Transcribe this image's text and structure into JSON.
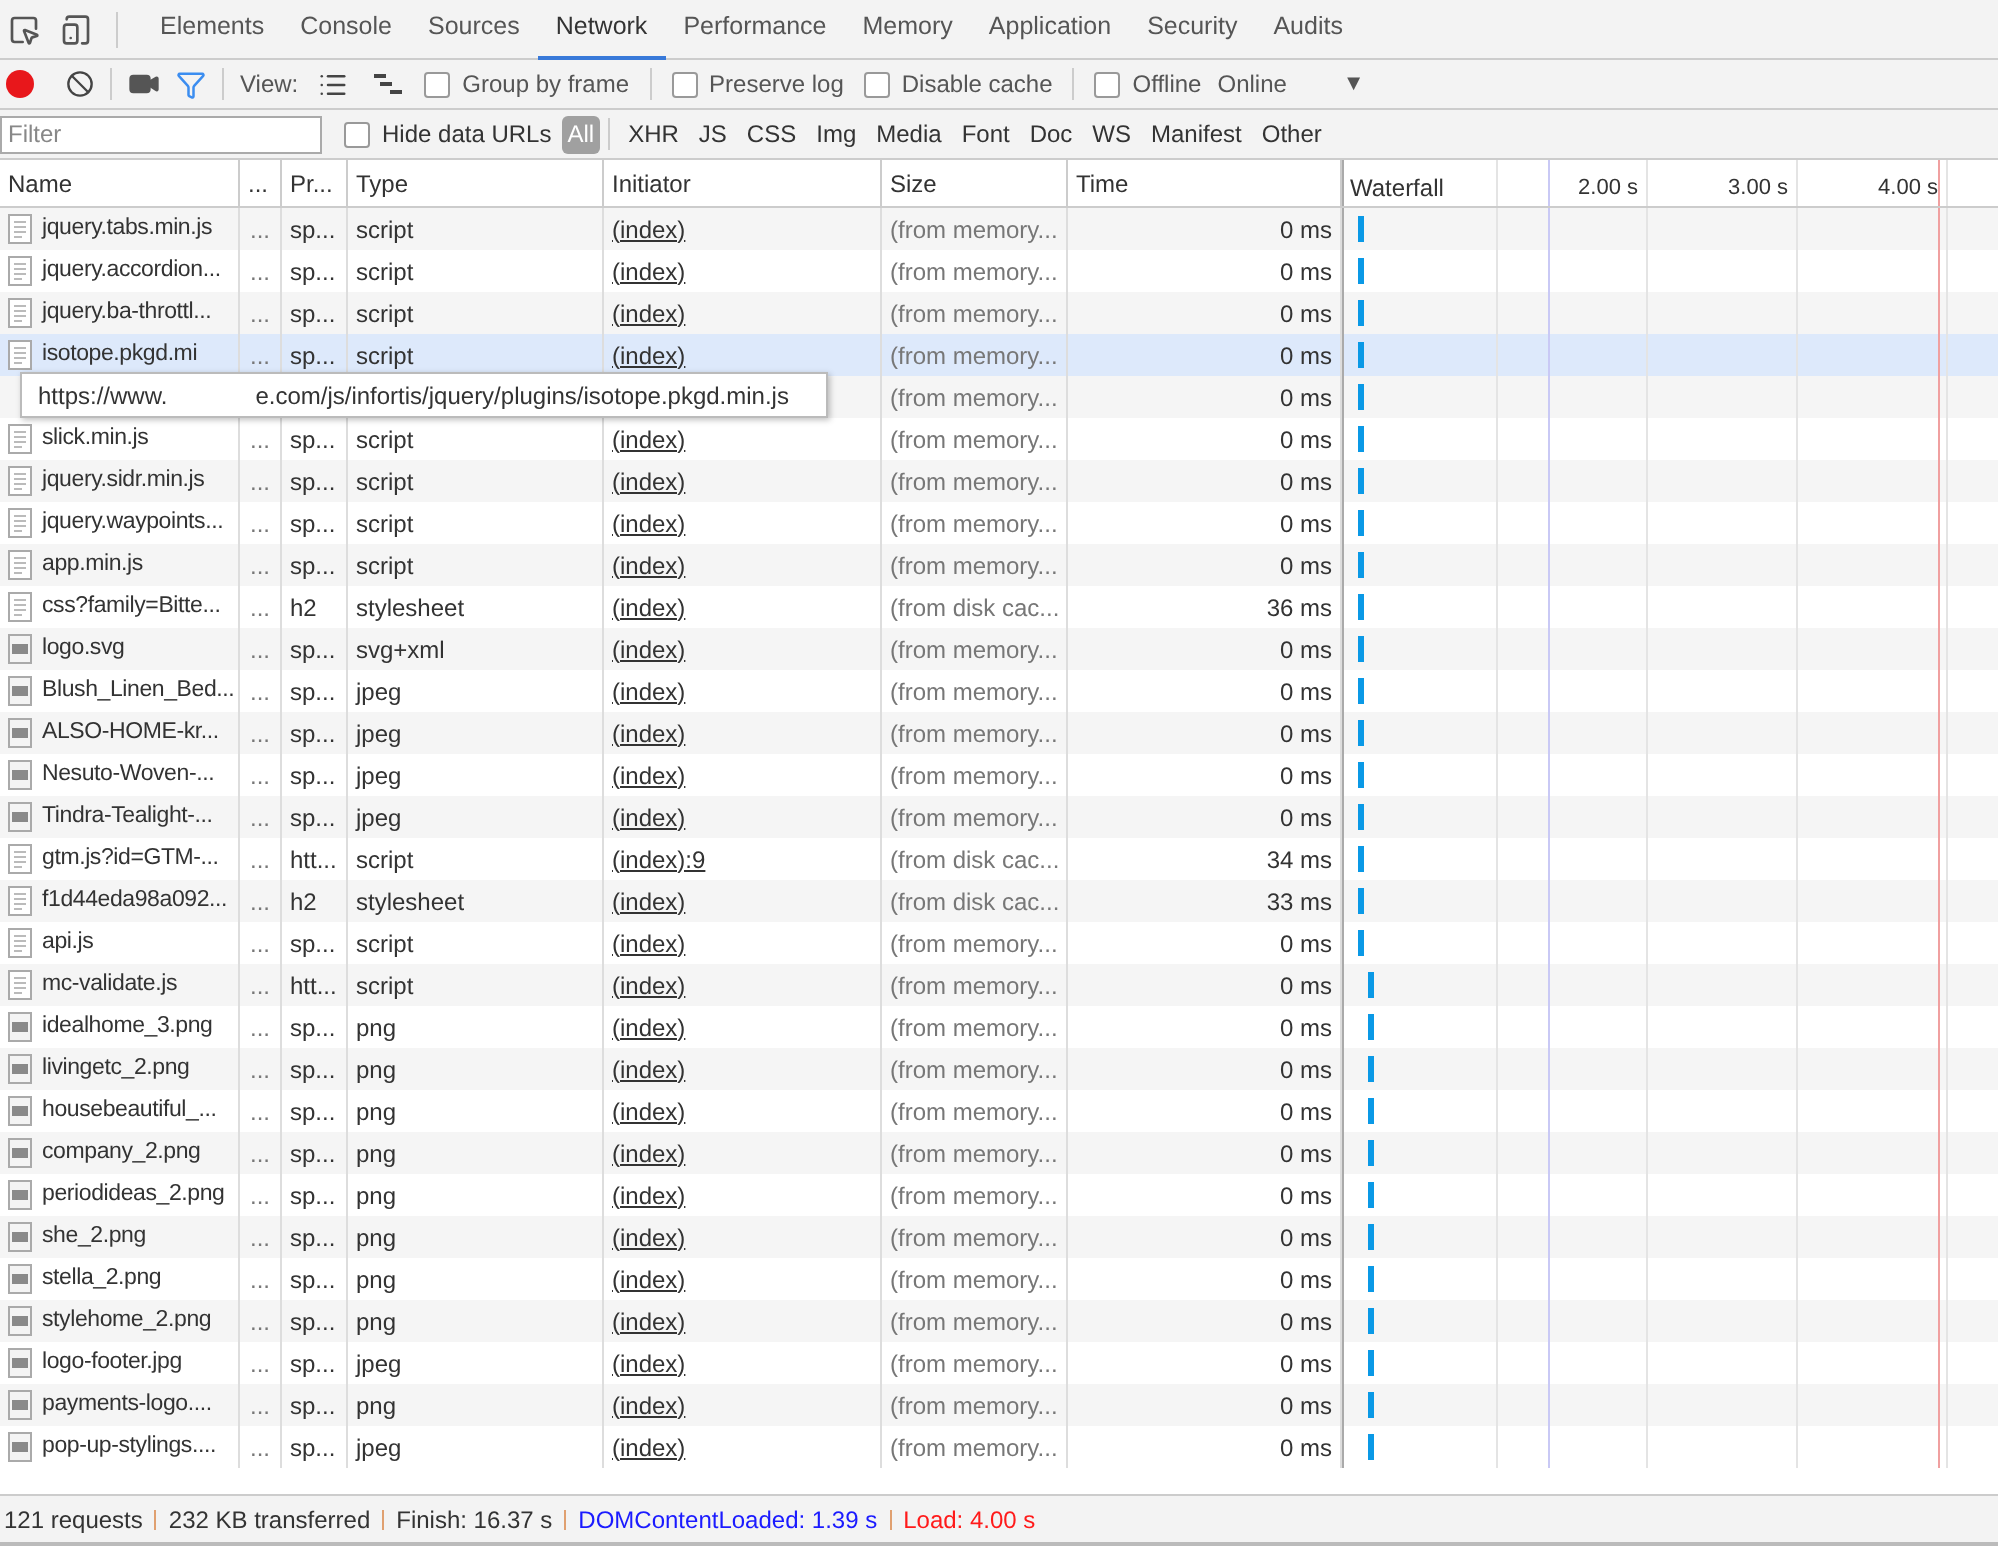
{
  "tabs": [
    {
      "label": "Elements",
      "selected": false
    },
    {
      "label": "Console",
      "selected": false
    },
    {
      "label": "Sources",
      "selected": false
    },
    {
      "label": "Network",
      "selected": true
    },
    {
      "label": "Performance",
      "selected": false
    },
    {
      "label": "Memory",
      "selected": false
    },
    {
      "label": "Application",
      "selected": false
    },
    {
      "label": "Security",
      "selected": false
    },
    {
      "label": "Audits",
      "selected": false
    }
  ],
  "toolbar": {
    "recording": true,
    "filter_on": true,
    "view_label": "View:",
    "checkboxes": [
      {
        "label": "Group by frame",
        "checked": false
      },
      {
        "label": "Preserve log",
        "checked": false
      },
      {
        "label": "Disable cache",
        "checked": false
      },
      {
        "label": "Offline",
        "checked": false
      }
    ],
    "throttle": "Online",
    "throttle_caret": "▼"
  },
  "filter_bar": {
    "placeholder": "Filter",
    "hide_data_urls": {
      "label": "Hide data URLs",
      "checked": false
    },
    "types": [
      {
        "label": "All",
        "selected": true
      },
      {
        "label": "XHR",
        "selected": false
      },
      {
        "label": "JS",
        "selected": false
      },
      {
        "label": "CSS",
        "selected": false
      },
      {
        "label": "Img",
        "selected": false
      },
      {
        "label": "Media",
        "selected": false
      },
      {
        "label": "Font",
        "selected": false
      },
      {
        "label": "Doc",
        "selected": false
      },
      {
        "label": "WS",
        "selected": false
      },
      {
        "label": "Manifest",
        "selected": false
      },
      {
        "label": "Other",
        "selected": false
      }
    ]
  },
  "table": {
    "columns": [
      "Name",
      "...",
      "Pr...",
      "Type",
      "Initiator",
      "Size",
      "Time",
      "Waterfall"
    ],
    "waterfall_ticks": [
      "2.00 s",
      "3.00 s",
      "4.00 s"
    ],
    "rows": [
      {
        "kind": "file",
        "name": "jquery.tabs.min.js",
        "column_2": "...",
        "protocol": "sp...",
        "type": "script",
        "initiator": "(index)",
        "size": "(from memory...",
        "time": "0 ms",
        "hovered": false
      },
      {
        "kind": "file",
        "name": "jquery.accordion...",
        "column_2": "...",
        "protocol": "sp...",
        "type": "script",
        "initiator": "(index)",
        "size": "(from memory...",
        "time": "0 ms",
        "hovered": false
      },
      {
        "kind": "file",
        "name": "jquery.ba-throttl...",
        "column_2": "...",
        "protocol": "sp...",
        "type": "script",
        "initiator": "(index)",
        "size": "(from memory...",
        "time": "0 ms",
        "hovered": false
      },
      {
        "kind": "file",
        "name": "isotope.pkgd.mi",
        "column_2": "...",
        "protocol": "sp...",
        "type": "script",
        "initiator": "(index)",
        "size": "(from memory...",
        "time": "0 ms",
        "hovered": true
      },
      {
        "kind": "covered",
        "size": "(from memory...",
        "time": "0 ms",
        "hovered": false
      },
      {
        "kind": "file",
        "name": "slick.min.js",
        "column_2": "...",
        "protocol": "sp...",
        "type": "script",
        "initiator": "(index)",
        "size": "(from memory...",
        "time": "0 ms",
        "hovered": false
      },
      {
        "kind": "file",
        "name": "jquery.sidr.min.js",
        "column_2": "...",
        "protocol": "sp...",
        "type": "script",
        "initiator": "(index)",
        "size": "(from memory...",
        "time": "0 ms",
        "hovered": false
      },
      {
        "kind": "file",
        "name": "jquery.waypoints...",
        "column_2": "...",
        "protocol": "sp...",
        "type": "script",
        "initiator": "(index)",
        "size": "(from memory...",
        "time": "0 ms",
        "hovered": false
      },
      {
        "kind": "file",
        "name": "app.min.js",
        "column_2": "...",
        "protocol": "sp...",
        "type": "script",
        "initiator": "(index)",
        "size": "(from memory...",
        "time": "0 ms",
        "hovered": false
      },
      {
        "kind": "file",
        "name": "css?family=Bitte...",
        "column_2": "...",
        "protocol": "h2",
        "type": "stylesheet",
        "initiator": "(index)",
        "size": "(from disk cac...",
        "time": "36 ms",
        "hovered": false
      },
      {
        "kind": "image",
        "name": "logo.svg",
        "column_2": "...",
        "protocol": "sp...",
        "type": "svg+xml",
        "initiator": "(index)",
        "size": "(from memory...",
        "time": "0 ms",
        "hovered": false
      },
      {
        "kind": "image",
        "name": "Blush_Linen_Bed...",
        "column_2": "...",
        "protocol": "sp...",
        "type": "jpeg",
        "initiator": "(index)",
        "size": "(from memory...",
        "time": "0 ms",
        "hovered": false
      },
      {
        "kind": "image",
        "name": "ALSO-HOME-kr...",
        "column_2": "...",
        "protocol": "sp...",
        "type": "jpeg",
        "initiator": "(index)",
        "size": "(from memory...",
        "time": "0 ms",
        "hovered": false
      },
      {
        "kind": "image",
        "name": "Nesuto-Woven-...",
        "column_2": "...",
        "protocol": "sp...",
        "type": "jpeg",
        "initiator": "(index)",
        "size": "(from memory...",
        "time": "0 ms",
        "hovered": false
      },
      {
        "kind": "image",
        "name": "Tindra-Tealight-...",
        "column_2": "...",
        "protocol": "sp...",
        "type": "jpeg",
        "initiator": "(index)",
        "size": "(from memory...",
        "time": "0 ms",
        "hovered": false
      },
      {
        "kind": "file",
        "name": "gtm.js?id=GTM-...",
        "column_2": "...",
        "protocol": "htt...",
        "type": "script",
        "initiator": "(index):9",
        "size": "(from disk cac...",
        "time": "34 ms",
        "hovered": false
      },
      {
        "kind": "file",
        "name": "f1d44eda98a092...",
        "column_2": "...",
        "protocol": "h2",
        "type": "stylesheet",
        "initiator": "(index)",
        "size": "(from disk cac...",
        "time": "33 ms",
        "hovered": false
      },
      {
        "kind": "file",
        "name": "api.js",
        "column_2": "...",
        "protocol": "sp...",
        "type": "script",
        "initiator": "(index)",
        "size": "(from memory...",
        "time": "0 ms",
        "hovered": false
      },
      {
        "kind": "file",
        "name": "mc-validate.js",
        "column_2": "...",
        "protocol": "htt...",
        "type": "script",
        "initiator": "(index)",
        "size": "(from memory...",
        "time": "0 ms",
        "hovered": false
      },
      {
        "kind": "image",
        "name": "idealhome_3.png",
        "column_2": "...",
        "protocol": "sp...",
        "type": "png",
        "initiator": "(index)",
        "size": "(from memory...",
        "time": "0 ms",
        "hovered": false
      },
      {
        "kind": "image",
        "name": "livingetc_2.png",
        "column_2": "...",
        "protocol": "sp...",
        "type": "png",
        "initiator": "(index)",
        "size": "(from memory...",
        "time": "0 ms",
        "hovered": false
      },
      {
        "kind": "image",
        "name": "housebeautiful_...",
        "column_2": "...",
        "protocol": "sp...",
        "type": "png",
        "initiator": "(index)",
        "size": "(from memory...",
        "time": "0 ms",
        "hovered": false
      },
      {
        "kind": "image",
        "name": "company_2.png",
        "column_2": "...",
        "protocol": "sp...",
        "type": "png",
        "initiator": "(index)",
        "size": "(from memory...",
        "time": "0 ms",
        "hovered": false
      },
      {
        "kind": "image",
        "name": "periodideas_2.png",
        "column_2": "...",
        "protocol": "sp...",
        "type": "png",
        "initiator": "(index)",
        "size": "(from memory...",
        "time": "0 ms",
        "hovered": false
      },
      {
        "kind": "image",
        "name": "she_2.png",
        "column_2": "...",
        "protocol": "sp...",
        "type": "png",
        "initiator": "(index)",
        "size": "(from memory...",
        "time": "0 ms",
        "hovered": false
      },
      {
        "kind": "image",
        "name": "stella_2.png",
        "column_2": "...",
        "protocol": "sp...",
        "type": "png",
        "initiator": "(index)",
        "size": "(from memory...",
        "time": "0 ms",
        "hovered": false
      },
      {
        "kind": "image",
        "name": "stylehome_2.png",
        "column_2": "...",
        "protocol": "sp...",
        "type": "png",
        "initiator": "(index)",
        "size": "(from memory...",
        "time": "0 ms",
        "hovered": false
      },
      {
        "kind": "image",
        "name": "logo-footer.jpg",
        "column_2": "...",
        "protocol": "sp...",
        "type": "jpeg",
        "initiator": "(index)",
        "size": "(from memory...",
        "time": "0 ms",
        "hovered": false
      },
      {
        "kind": "image",
        "name": "payments-logo....",
        "column_2": "...",
        "protocol": "sp...",
        "type": "png",
        "initiator": "(index)",
        "size": "(from memory...",
        "time": "0 ms",
        "hovered": false
      },
      {
        "kind": "image",
        "name": "pop-up-stylings....",
        "column_2": "...",
        "protocol": "sp...",
        "type": "jpeg",
        "initiator": "(index)",
        "size": "(from memory...",
        "time": "0 ms",
        "hovered": false
      }
    ]
  },
  "tooltip": {
    "text_before": "https://www.",
    "text_after": "e.com/js/infortis/jquery/plugins/isotope.pkgd.min.js"
  },
  "status_bar": [
    {
      "text": "121 requests",
      "color": "#333333"
    },
    {
      "text": "232 KB transferred",
      "color": "#333333"
    },
    {
      "text": "Finish: 16.37 s",
      "color": "#333333"
    },
    {
      "text": "DOMContentLoaded: 1.39 s",
      "color": "#1a1aff"
    },
    {
      "text": "Load: 4.00 s",
      "color": "#ff1a1a"
    }
  ]
}
